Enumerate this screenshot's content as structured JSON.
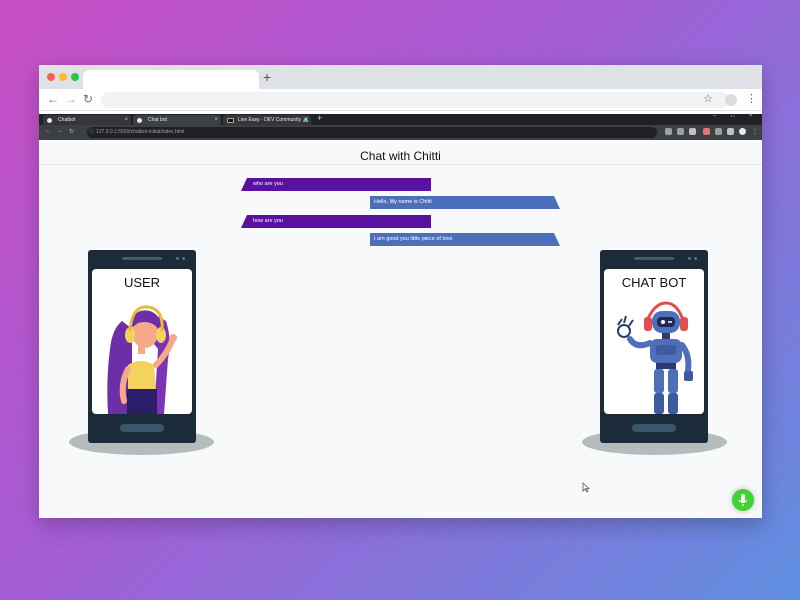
{
  "inner_tabs": [
    {
      "title": "Chatbot",
      "close": "×"
    },
    {
      "title": "Chat bot",
      "close": "×"
    },
    {
      "title": "Live Easy - DEV Community 👩‍💻",
      "close": "×"
    }
  ],
  "inner_url": "127.0.0.1:5500/chatbot-initial/index.html",
  "page": {
    "title": "Chat with Chitti",
    "messages": [
      {
        "sender": "user",
        "text": "who are you"
      },
      {
        "sender": "bot",
        "text": "Hello, My name is Chitti"
      },
      {
        "sender": "user",
        "text": "how are you"
      },
      {
        "sender": "bot",
        "text": "I am good you little piece of love"
      }
    ],
    "user_label": "USER",
    "bot_label": "CHAT BOT"
  },
  "icons": {
    "plus": "+",
    "back": "←",
    "forward": "→",
    "reload": "↻",
    "star": "☆",
    "menu": "⋮",
    "info": "ⓘ",
    "minimize": "–",
    "maximize": "□",
    "close": "×",
    "mic": "microphone-icon"
  },
  "colors": {
    "user_bubble": "#5b11a0",
    "bot_bubble": "#4b6fb8",
    "mic_button": "#3fd32f"
  }
}
